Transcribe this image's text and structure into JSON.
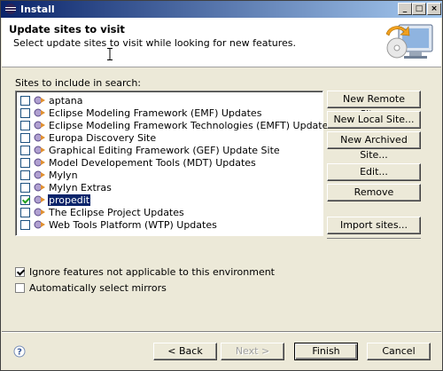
{
  "window": {
    "title": "Install"
  },
  "title_buttons": {
    "minimize": "_",
    "maximize": "□",
    "close": "×"
  },
  "header": {
    "title": "Update sites to visit",
    "description": "Select update sites to visit while looking for new features."
  },
  "sites_label": "Sites to include in search:",
  "sites": [
    {
      "label": "aptana",
      "checked": false
    },
    {
      "label": "Eclipse Modeling Framework (EMF) Updates",
      "checked": false
    },
    {
      "label": "Eclipse Modeling Framework Technologies (EMFT) Updates",
      "checked": false
    },
    {
      "label": "Europa Discovery Site",
      "checked": false
    },
    {
      "label": "Graphical Editing Framework (GEF) Update Site",
      "checked": false
    },
    {
      "label": "Model Developement Tools (MDT) Updates",
      "checked": false
    },
    {
      "label": "Mylyn",
      "checked": false
    },
    {
      "label": "Mylyn Extras",
      "checked": false
    },
    {
      "label": "propedit",
      "checked": true,
      "selected": true
    },
    {
      "label": "The Eclipse Project Updates",
      "checked": false
    },
    {
      "label": "Web Tools Platform (WTP) Updates",
      "checked": false
    }
  ],
  "side_buttons": {
    "new_remote": "New Remote Site...",
    "new_local": "New Local Site...",
    "new_archived": "New Archived Site...",
    "edit": "Edit...",
    "remove": "Remove",
    "import": "Import sites..."
  },
  "options": {
    "ignore_features": {
      "label": "Ignore features not applicable to this environment",
      "checked": true
    },
    "auto_mirrors": {
      "label": "Automatically select mirrors",
      "checked": false
    }
  },
  "footer": {
    "back": "< Back",
    "next": "Next >",
    "finish": "Finish",
    "cancel": "Cancel"
  },
  "icons": {
    "help": "help-icon",
    "app": "eclipse-icon",
    "banner": "install-banner-icon",
    "site": "update-site-icon"
  }
}
